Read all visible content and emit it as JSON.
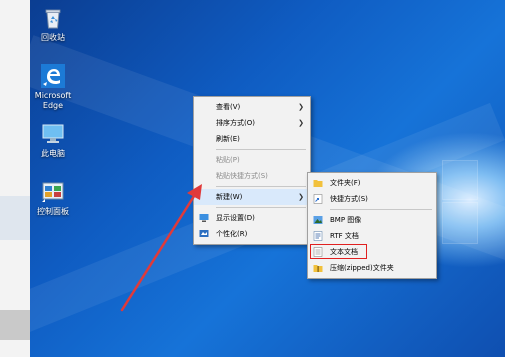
{
  "desktop": {
    "icons": [
      {
        "label": "回收站",
        "icon": "recycle-bin-icon"
      },
      {
        "label": "Microsoft Edge",
        "icon": "edge-icon"
      },
      {
        "label": "此电脑",
        "icon": "computer-icon"
      },
      {
        "label": "控制面板",
        "icon": "control-panel-icon"
      }
    ]
  },
  "context_menu": {
    "items": [
      {
        "label": "查看(V)",
        "submenu": true
      },
      {
        "label": "排序方式(O)",
        "submenu": true
      },
      {
        "label": "刷新(E)"
      },
      {
        "label": "粘贴(P)",
        "disabled": true
      },
      {
        "label": "粘贴快捷方式(S)",
        "disabled": true
      },
      {
        "label": "新建(W)",
        "submenu": true,
        "highlighted": true
      },
      {
        "label": "显示设置(D)",
        "icon": "display-settings-icon"
      },
      {
        "label": "个性化(R)",
        "icon": "personalize-icon"
      }
    ]
  },
  "new_submenu": {
    "items": [
      {
        "label": "文件夹(F)",
        "icon": "folder-icon"
      },
      {
        "label": "快捷方式(S)",
        "icon": "shortcut-icon"
      },
      {
        "label": "BMP 图像",
        "icon": "bmp-image-icon"
      },
      {
        "label": "RTF 文档",
        "icon": "rtf-document-icon"
      },
      {
        "label": "文本文档",
        "icon": "text-document-icon",
        "annotated": true
      },
      {
        "label": "压缩(zipped)文件夹",
        "icon": "zip-folder-icon"
      }
    ]
  },
  "annotation": {
    "arrow_color": "#e03a3a",
    "box_color": "#e02020"
  }
}
